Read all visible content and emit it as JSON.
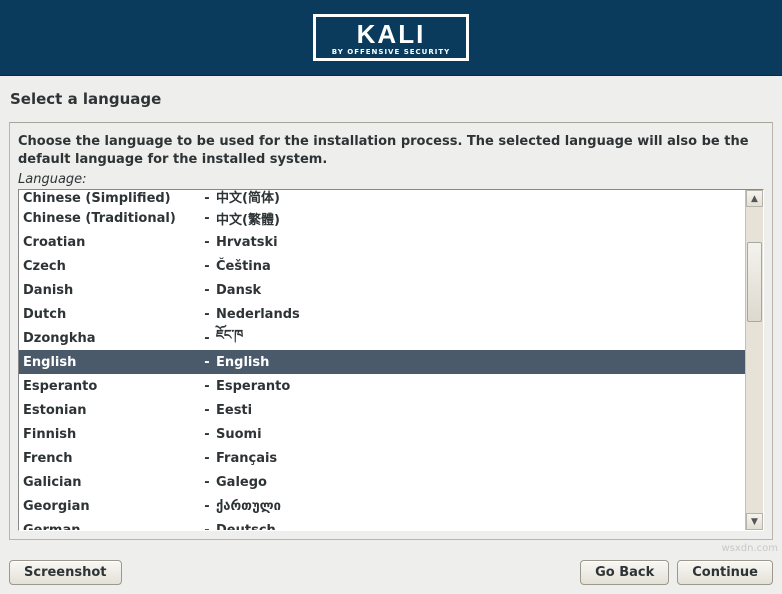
{
  "brand": {
    "title": "KALI",
    "subtitle": "BY OFFENSIVE SECURITY"
  },
  "page_title": "Select a language",
  "instructions": "Choose the language to be used for the installation process. The selected language will also be the default language for the installed system.",
  "field_label": "Language:",
  "selected_index": 7,
  "languages": [
    {
      "name": "Chinese (Simplified)",
      "native": "中文(简体)"
    },
    {
      "name": "Chinese (Traditional)",
      "native": "中文(繁體)"
    },
    {
      "name": "Croatian",
      "native": "Hrvatski"
    },
    {
      "name": "Czech",
      "native": "Čeština"
    },
    {
      "name": "Danish",
      "native": "Dansk"
    },
    {
      "name": "Dutch",
      "native": "Nederlands"
    },
    {
      "name": "Dzongkha",
      "native": "ཇོང་ཁ"
    },
    {
      "name": "English",
      "native": "English"
    },
    {
      "name": "Esperanto",
      "native": "Esperanto"
    },
    {
      "name": "Estonian",
      "native": "Eesti"
    },
    {
      "name": "Finnish",
      "native": "Suomi"
    },
    {
      "name": "French",
      "native": "Français"
    },
    {
      "name": "Galician",
      "native": "Galego"
    },
    {
      "name": "Georgian",
      "native": "ქართული"
    },
    {
      "name": "German",
      "native": "Deutsch"
    }
  ],
  "footer": {
    "screenshot": "Screenshot",
    "go_back": "Go Back",
    "continue": "Continue"
  },
  "watermark": "wsxdn.com"
}
